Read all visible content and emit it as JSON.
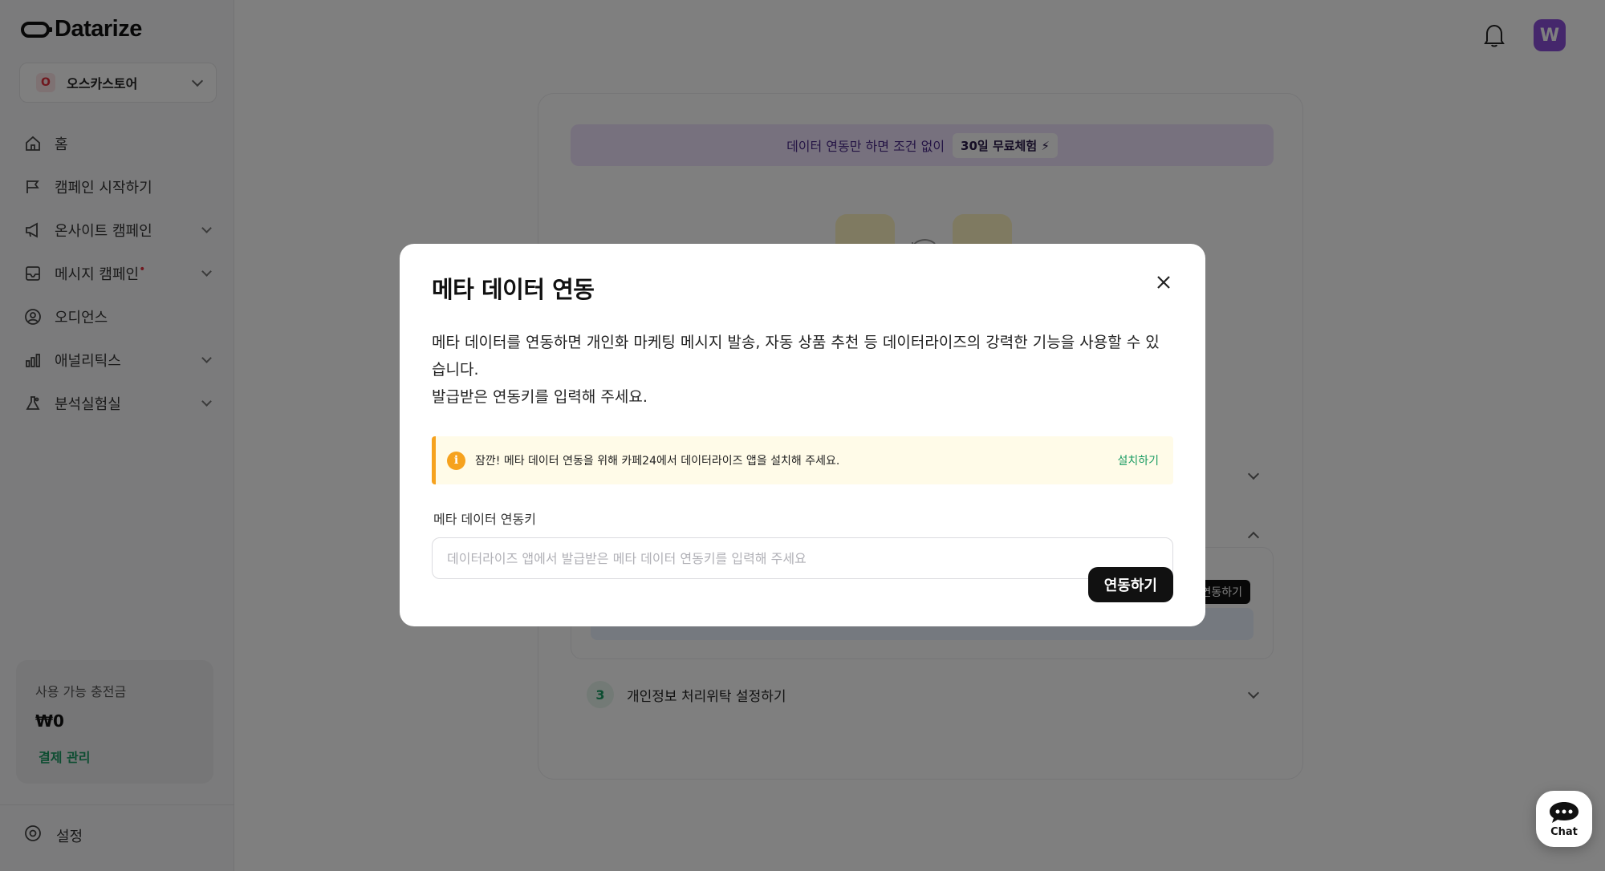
{
  "app": {
    "logo_text": "Datarize"
  },
  "sidebar": {
    "store": {
      "badge": "O",
      "name": "오스카스토어"
    },
    "items": [
      {
        "label": "홈",
        "icon": "home-icon",
        "has_submenu": false
      },
      {
        "label": "캠페인 시작하기",
        "icon": "flag-icon",
        "has_submenu": false
      },
      {
        "label": "온사이트 캠페인",
        "icon": "megaphone-icon",
        "has_submenu": true
      },
      {
        "label": "메시지 캠페인",
        "icon": "message-icon",
        "has_submenu": true,
        "dot": "•"
      },
      {
        "label": "오디언스",
        "icon": "user-icon",
        "has_submenu": false
      },
      {
        "label": "애널리틱스",
        "icon": "bar-chart-icon",
        "has_submenu": true
      },
      {
        "label": "분석실험실",
        "icon": "flask-icon",
        "has_submenu": true
      }
    ],
    "charge": {
      "label": "사용 가능 충전금",
      "value": "₩0",
      "link": "결제 관리"
    },
    "settings_label": "설정"
  },
  "header": {
    "avatar_initial": "W"
  },
  "background_card": {
    "promo_text": "데이터 연동만 하면 조건 없이",
    "promo_badge": "30일 무료체험",
    "bg_connect_label": "연동하기",
    "step3_number": "3",
    "step3_title": "개인정보 처리위탁 설정하기"
  },
  "modal": {
    "title": "메타 데이터 연동",
    "description_line1": "메타 데이터를 연동하면 개인화 마케팅 메시지 발송, 자동 상품 추천 등 데이터라이즈의 강력한 기능을 사용할 수 있습니다.",
    "description_line2": "발급받은 연동키를 입력해 주세요.",
    "alert_text": "잠깐! 메타 데이터 연동을 위해 카페24에서 데이터라이즈 앱을 설치해 주세요.",
    "alert_link": "설치하기",
    "field_label": "메타 데이터 연동키",
    "field_placeholder": "데이터라이즈 앱에서 발급받은 메타 데이터 연동키를 입력해 주세요",
    "field_value": "",
    "submit_label": "연동하기"
  },
  "chat": {
    "label": "Chat"
  },
  "colors": {
    "accent_green": "#1a9b63",
    "warning_orange": "#f6a21e",
    "avatar_purple": "#8a4fd8",
    "promo_purple_bg": "#efe3fd",
    "store_badge_red": "#e0303f"
  }
}
